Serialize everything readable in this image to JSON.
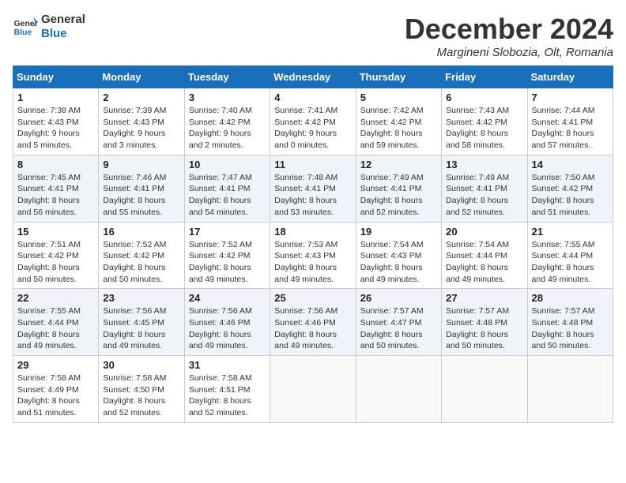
{
  "header": {
    "logo_line1": "General",
    "logo_line2": "Blue",
    "month_title": "December 2024",
    "location": "Margineni Slobozia, Olt, Romania"
  },
  "days_of_week": [
    "Sunday",
    "Monday",
    "Tuesday",
    "Wednesday",
    "Thursday",
    "Friday",
    "Saturday"
  ],
  "weeks": [
    [
      {
        "day": "1",
        "info": "Sunrise: 7:38 AM\nSunset: 4:43 PM\nDaylight: 9 hours\nand 5 minutes."
      },
      {
        "day": "2",
        "info": "Sunrise: 7:39 AM\nSunset: 4:43 PM\nDaylight: 9 hours\nand 3 minutes."
      },
      {
        "day": "3",
        "info": "Sunrise: 7:40 AM\nSunset: 4:42 PM\nDaylight: 9 hours\nand 2 minutes."
      },
      {
        "day": "4",
        "info": "Sunrise: 7:41 AM\nSunset: 4:42 PM\nDaylight: 9 hours\nand 0 minutes."
      },
      {
        "day": "5",
        "info": "Sunrise: 7:42 AM\nSunset: 4:42 PM\nDaylight: 8 hours\nand 59 minutes."
      },
      {
        "day": "6",
        "info": "Sunrise: 7:43 AM\nSunset: 4:42 PM\nDaylight: 8 hours\nand 58 minutes."
      },
      {
        "day": "7",
        "info": "Sunrise: 7:44 AM\nSunset: 4:41 PM\nDaylight: 8 hours\nand 57 minutes."
      }
    ],
    [
      {
        "day": "8",
        "info": "Sunrise: 7:45 AM\nSunset: 4:41 PM\nDaylight: 8 hours\nand 56 minutes."
      },
      {
        "day": "9",
        "info": "Sunrise: 7:46 AM\nSunset: 4:41 PM\nDaylight: 8 hours\nand 55 minutes."
      },
      {
        "day": "10",
        "info": "Sunrise: 7:47 AM\nSunset: 4:41 PM\nDaylight: 8 hours\nand 54 minutes."
      },
      {
        "day": "11",
        "info": "Sunrise: 7:48 AM\nSunset: 4:41 PM\nDaylight: 8 hours\nand 53 minutes."
      },
      {
        "day": "12",
        "info": "Sunrise: 7:49 AM\nSunset: 4:41 PM\nDaylight: 8 hours\nand 52 minutes."
      },
      {
        "day": "13",
        "info": "Sunrise: 7:49 AM\nSunset: 4:41 PM\nDaylight: 8 hours\nand 52 minutes."
      },
      {
        "day": "14",
        "info": "Sunrise: 7:50 AM\nSunset: 4:42 PM\nDaylight: 8 hours\nand 51 minutes."
      }
    ],
    [
      {
        "day": "15",
        "info": "Sunrise: 7:51 AM\nSunset: 4:42 PM\nDaylight: 8 hours\nand 50 minutes."
      },
      {
        "day": "16",
        "info": "Sunrise: 7:52 AM\nSunset: 4:42 PM\nDaylight: 8 hours\nand 50 minutes."
      },
      {
        "day": "17",
        "info": "Sunrise: 7:52 AM\nSunset: 4:42 PM\nDaylight: 8 hours\nand 49 minutes."
      },
      {
        "day": "18",
        "info": "Sunrise: 7:53 AM\nSunset: 4:43 PM\nDaylight: 8 hours\nand 49 minutes."
      },
      {
        "day": "19",
        "info": "Sunrise: 7:54 AM\nSunset: 4:43 PM\nDaylight: 8 hours\nand 49 minutes."
      },
      {
        "day": "20",
        "info": "Sunrise: 7:54 AM\nSunset: 4:44 PM\nDaylight: 8 hours\nand 49 minutes."
      },
      {
        "day": "21",
        "info": "Sunrise: 7:55 AM\nSunset: 4:44 PM\nDaylight: 8 hours\nand 49 minutes."
      }
    ],
    [
      {
        "day": "22",
        "info": "Sunrise: 7:55 AM\nSunset: 4:44 PM\nDaylight: 8 hours\nand 49 minutes."
      },
      {
        "day": "23",
        "info": "Sunrise: 7:56 AM\nSunset: 4:45 PM\nDaylight: 8 hours\nand 49 minutes."
      },
      {
        "day": "24",
        "info": "Sunrise: 7:56 AM\nSunset: 4:46 PM\nDaylight: 8 hours\nand 49 minutes."
      },
      {
        "day": "25",
        "info": "Sunrise: 7:56 AM\nSunset: 4:46 PM\nDaylight: 8 hours\nand 49 minutes."
      },
      {
        "day": "26",
        "info": "Sunrise: 7:57 AM\nSunset: 4:47 PM\nDaylight: 8 hours\nand 50 minutes."
      },
      {
        "day": "27",
        "info": "Sunrise: 7:57 AM\nSunset: 4:48 PM\nDaylight: 8 hours\nand 50 minutes."
      },
      {
        "day": "28",
        "info": "Sunrise: 7:57 AM\nSunset: 4:48 PM\nDaylight: 8 hours\nand 50 minutes."
      }
    ],
    [
      {
        "day": "29",
        "info": "Sunrise: 7:58 AM\nSunset: 4:49 PM\nDaylight: 8 hours\nand 51 minutes."
      },
      {
        "day": "30",
        "info": "Sunrise: 7:58 AM\nSunset: 4:50 PM\nDaylight: 8 hours\nand 52 minutes."
      },
      {
        "day": "31",
        "info": "Sunrise: 7:58 AM\nSunset: 4:51 PM\nDaylight: 8 hours\nand 52 minutes."
      },
      {
        "day": "",
        "info": ""
      },
      {
        "day": "",
        "info": ""
      },
      {
        "day": "",
        "info": ""
      },
      {
        "day": "",
        "info": ""
      }
    ]
  ]
}
